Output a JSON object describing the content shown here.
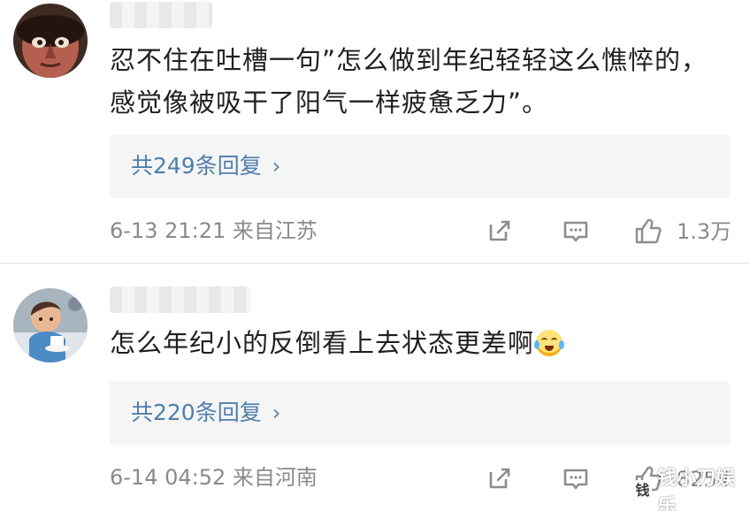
{
  "comments": [
    {
      "text": "忍不住在吐槽一句”怎么做到年纪轻轻这么憔悴的，感觉像被吸干了阳气一样疲惫乏力”。",
      "replies": "共249条回复",
      "time": "6-13 21:21",
      "location": "来自江苏",
      "likes": "1.3万",
      "avatar_icon": "cartoon-avatar-icon"
    },
    {
      "text": "怎么年纪小的反倒看上去状态更差啊",
      "replies": "共220条回复",
      "time": "6-14 04:52",
      "location": "来自河南",
      "likes": "8254",
      "avatar_icon": "child-photo-avatar-icon"
    }
  ],
  "icons": {
    "chevron": "›",
    "emoji": "crying-laughing-emoji-icon"
  },
  "watermark": {
    "text": "钱小刀娱乐",
    "logo": "钱"
  },
  "colors": {
    "link": "#4e7fad",
    "meta": "#8a8a8a",
    "text": "#202020",
    "reply_bg": "#f5f5f5"
  }
}
